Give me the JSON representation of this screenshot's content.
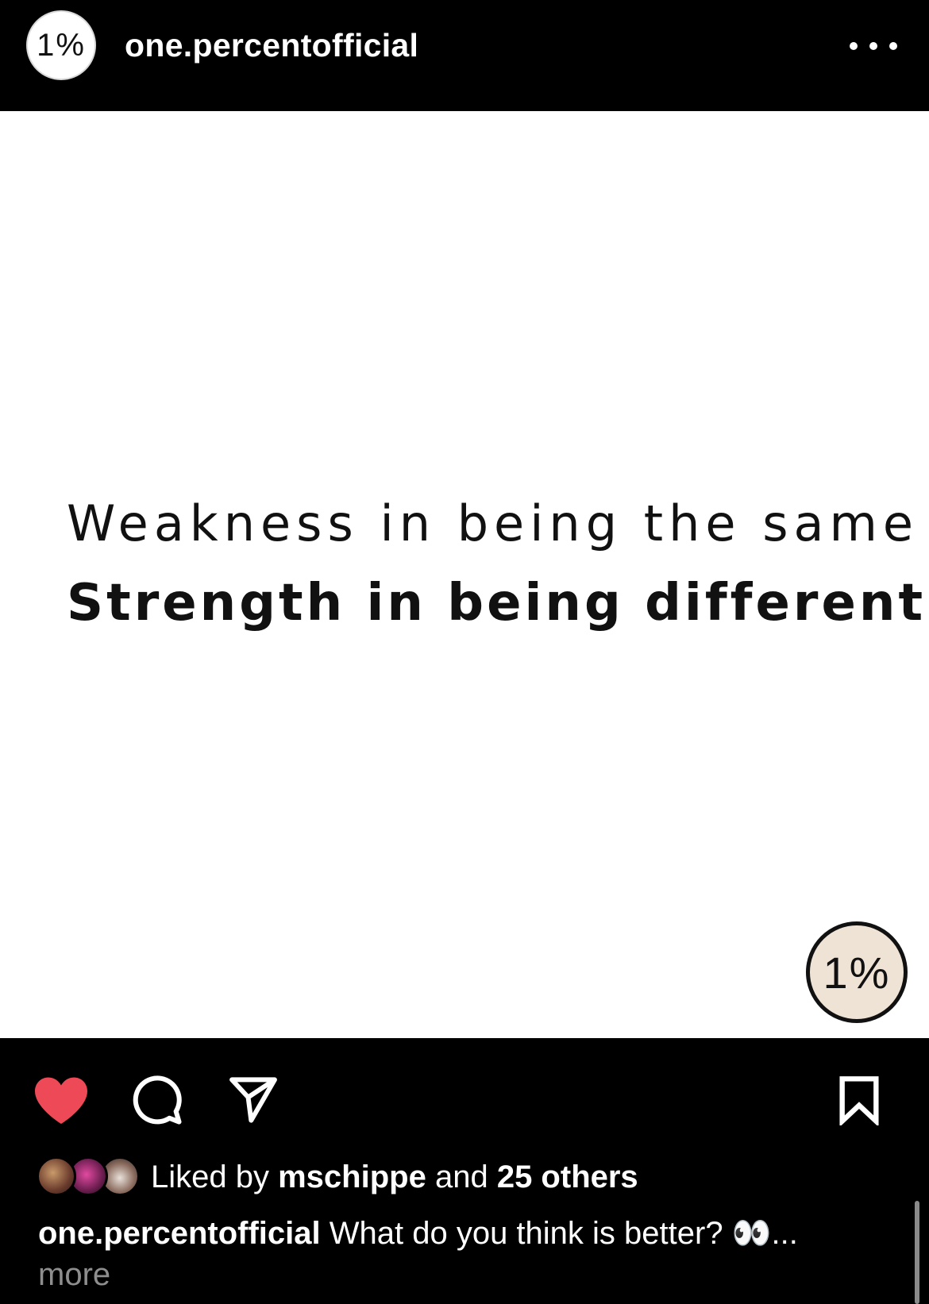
{
  "header": {
    "avatar_text": "1%",
    "username": "one.percentofficial",
    "more_icon": "more-horizontal-icon"
  },
  "post": {
    "quote_line1": "Weakness in being the same",
    "quote_line2": "Strength in being different",
    "watermark_text": "1%"
  },
  "actions": {
    "like_icon": "heart-filled-icon",
    "comment_icon": "comment-icon",
    "share_icon": "send-icon",
    "save_icon": "bookmark-icon",
    "like_color": "#ed4956"
  },
  "likes": {
    "prefix": "Liked by",
    "user": "mschippe",
    "joiner": "and",
    "others": "25 others"
  },
  "caption": {
    "username": "one.percentofficial",
    "text": "What do you think is better? 👀...",
    "more": "more"
  }
}
